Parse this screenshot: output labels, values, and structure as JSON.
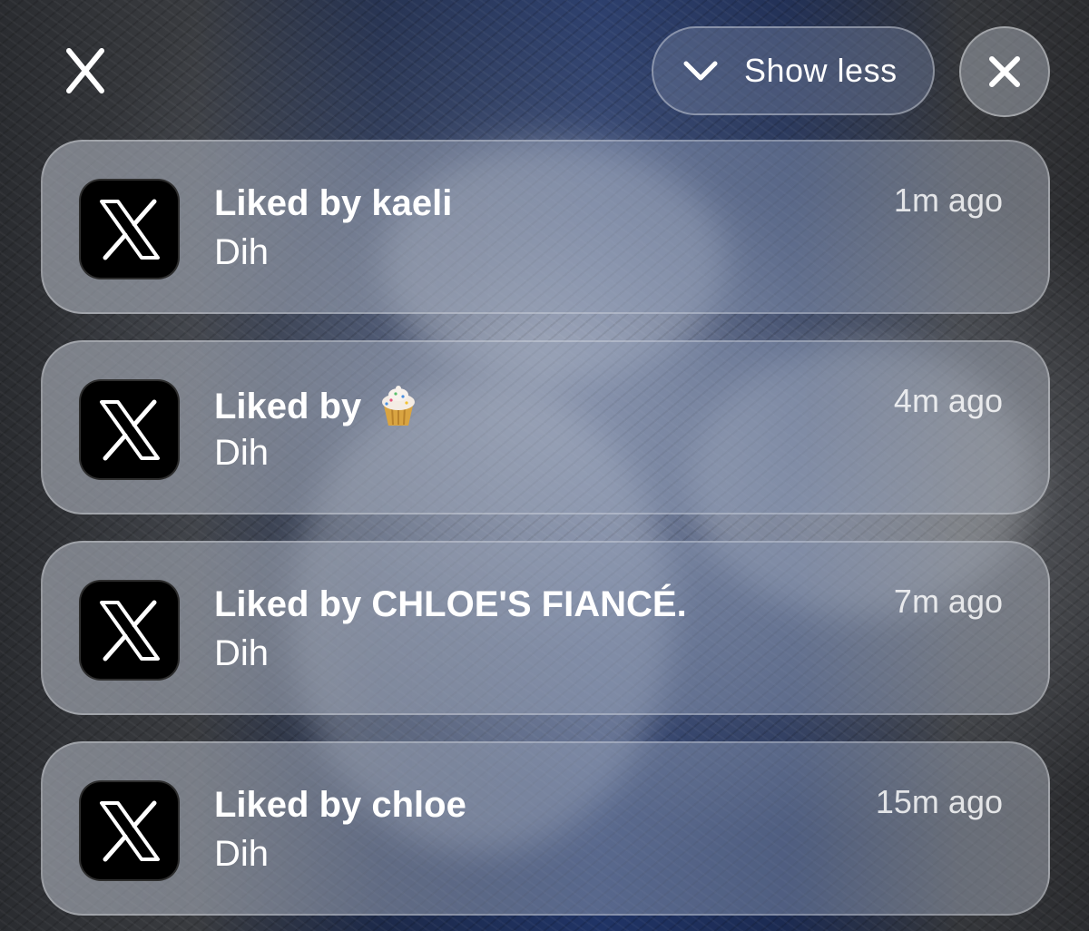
{
  "header": {
    "show_less_label": "Show less",
    "left_icon": "x-logo-icon",
    "chevron_icon": "chevron-down-icon",
    "clear_icon": "close-icon"
  },
  "notifications": [
    {
      "app_icon": "x-logo-icon",
      "title": "Liked by kaeli",
      "body": "Dih",
      "time": "1m ago"
    },
    {
      "app_icon": "x-logo-icon",
      "title": "Liked by",
      "title_emoji": "cupcake-icon",
      "body": "Dih",
      "time": "4m ago"
    },
    {
      "app_icon": "x-logo-icon",
      "title": "Liked by CHLOE'S FIANCÉ.",
      "body": "Dih",
      "time": "7m ago"
    },
    {
      "app_icon": "x-logo-icon",
      "title": "Liked by chloe",
      "body": "Dih",
      "time": "15m ago"
    }
  ],
  "colors": {
    "text": "#ffffff",
    "app_icon_bg": "#000000"
  }
}
